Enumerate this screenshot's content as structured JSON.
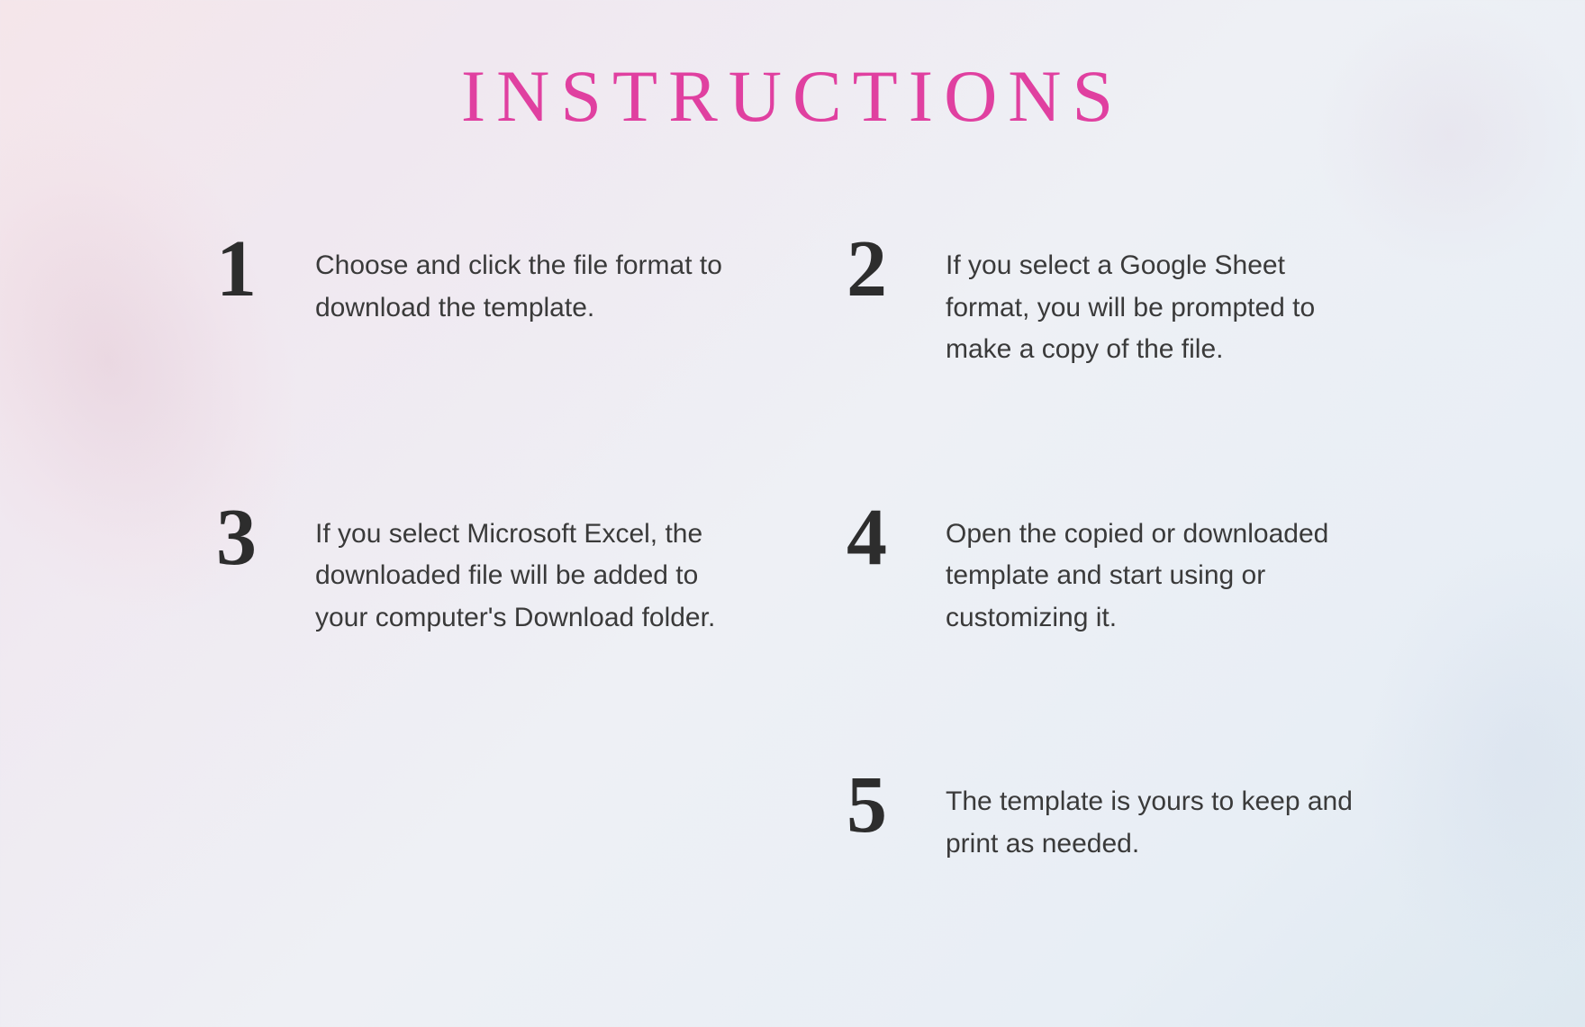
{
  "page": {
    "title": "INSTRUCTIONS",
    "background": {
      "gradient_start": "#f5e6ea",
      "gradient_end": "#dde8f0"
    }
  },
  "steps": [
    {
      "number": "1",
      "text": "Choose and click the file format to download the template."
    },
    {
      "number": "2",
      "text": "If you select a Google Sheet format, you will be prompted to make a copy of the file."
    },
    {
      "number": "3",
      "text": "If you select Microsoft Excel, the downloaded file will be added to your computer's Download  folder."
    },
    {
      "number": "4",
      "text": "Open the copied or downloaded template and start using or customizing it."
    },
    {
      "number": "5",
      "text": "The template is yours to keep and print as needed."
    }
  ]
}
